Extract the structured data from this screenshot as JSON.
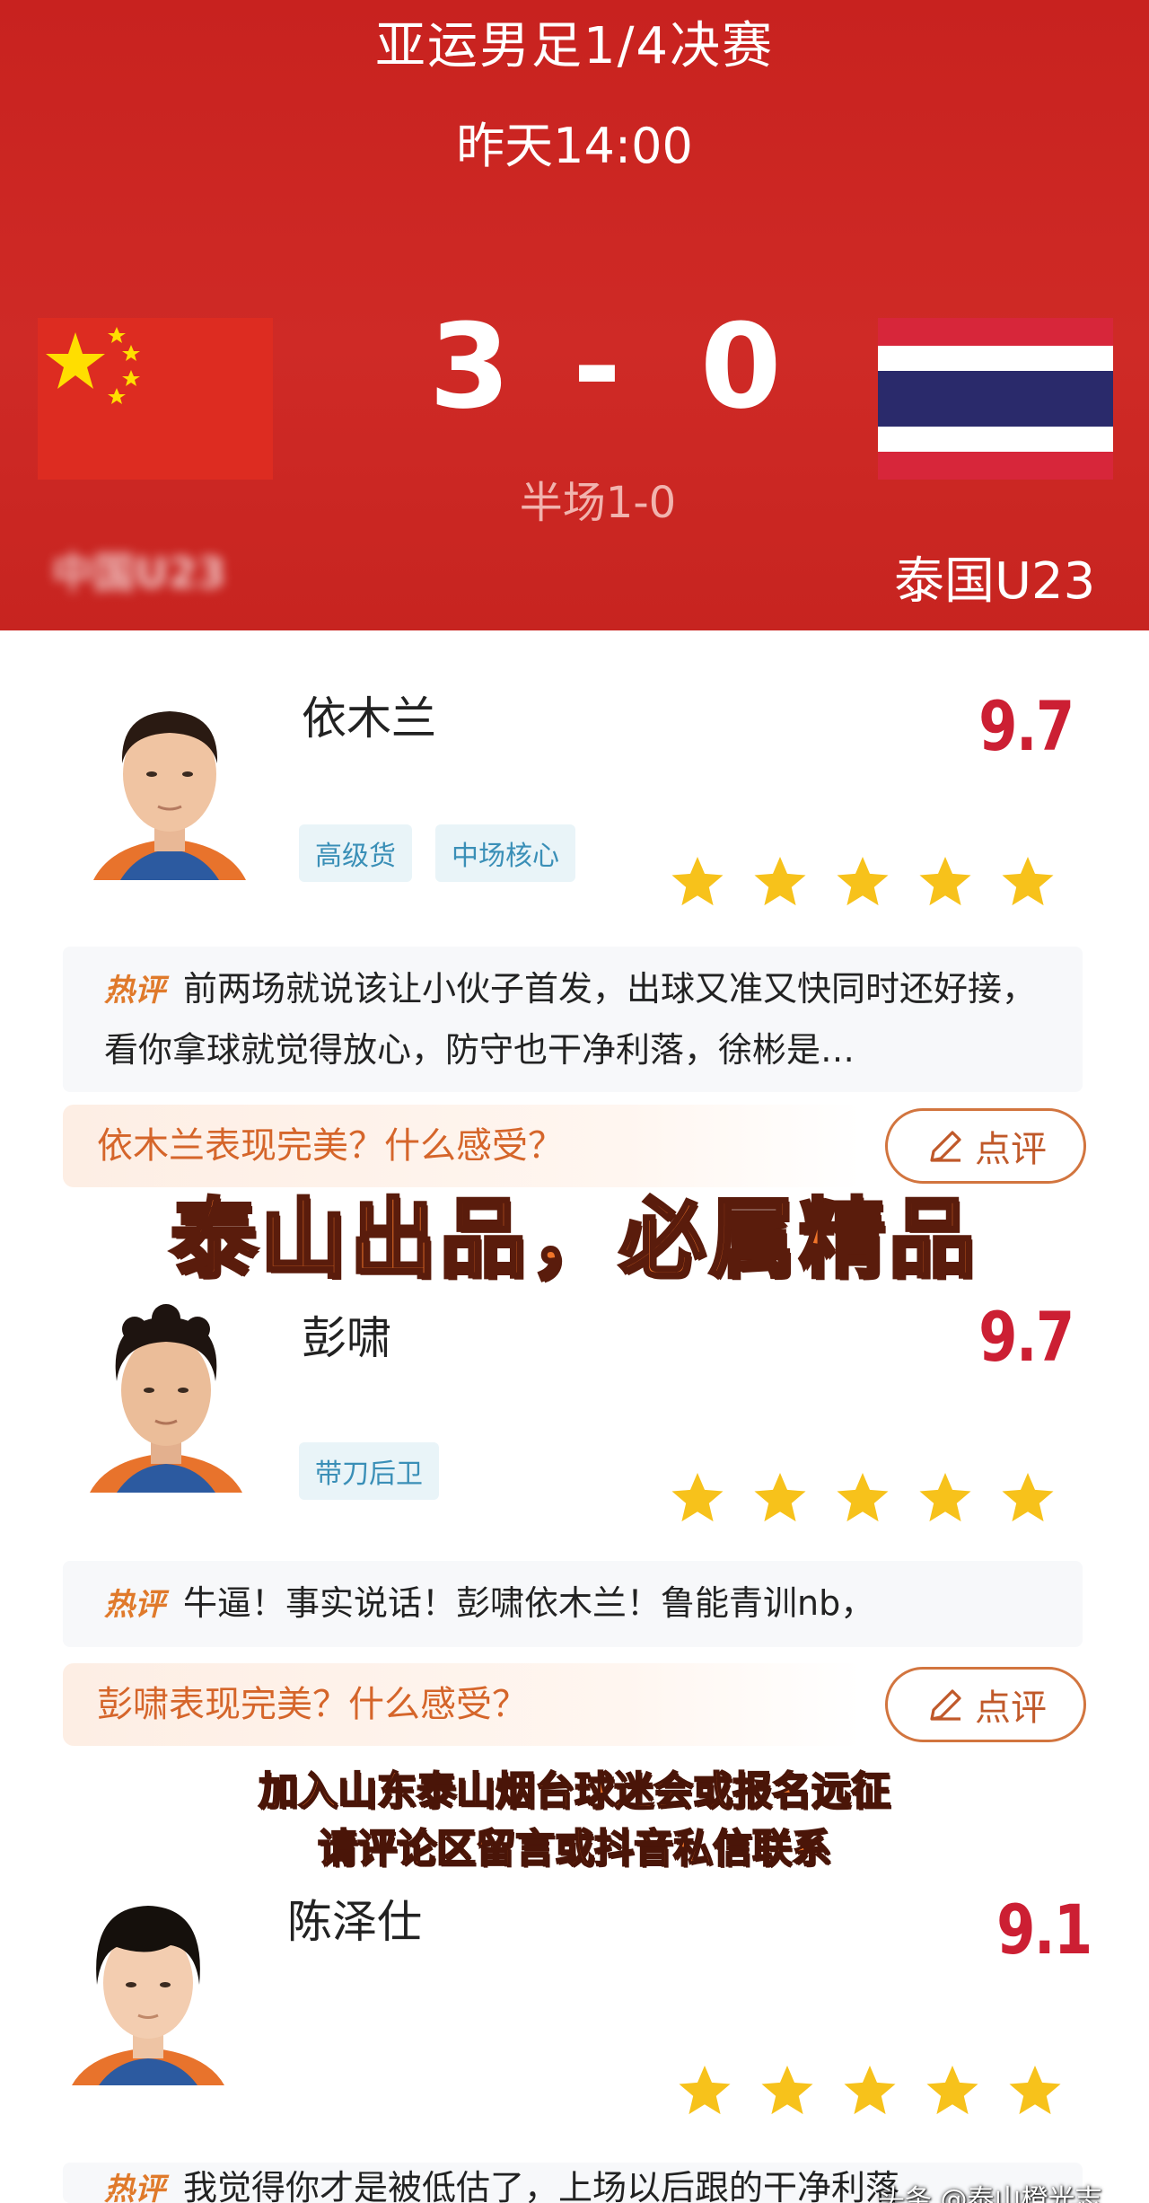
{
  "match": {
    "title": "亚运男足1/4决赛",
    "time": "昨天14:00",
    "home_score": "3",
    "separator": "-",
    "away_score": "0",
    "halftime": "半场1-0",
    "home_team": "中国U23",
    "away_team": "泰国U23"
  },
  "players": [
    {
      "name": "依木兰",
      "rating": "9.7",
      "tags": [
        "高级货",
        "中场核心"
      ],
      "stars": 5,
      "hot_badge": "热评",
      "hot_comment": "前两场就说该让小伙子首发，出球又准又快同时还好接，看你拿球就觉得放心，防守也干净利落，徐彬是…",
      "prompt": "依木兰表现完美？什么感受？",
      "review_label": "点评"
    },
    {
      "name": "彭啸",
      "rating": "9.7",
      "tags": [
        "带刀后卫"
      ],
      "stars": 5,
      "hot_badge": "热评",
      "hot_comment": "牛逼！事实说话！彭啸依木兰！鲁能青训nb，",
      "prompt": "彭啸表现完美？什么感受？",
      "review_label": "点评"
    },
    {
      "name": "陈泽仕",
      "rating": "9.1",
      "stars": 5,
      "hot_badge": "热评",
      "hot_comment": "我觉得你才是被低估了，上场以后跟的干净利落"
    }
  ],
  "overlay": {
    "big_caption": "泰山出品，必属精品",
    "line1": "加入山东泰山烟台球迷会或报名远征",
    "line2": "请评论区留言或抖音私信联系"
  },
  "watermark": "头条 @泰山橙光志",
  "colors": {
    "header_red": "#c8221f",
    "rating_red": "#cc1f33",
    "star_yellow": "#f7c21b",
    "tag_blue": "#3a8fb7",
    "accent_orange": "#d5652a"
  }
}
